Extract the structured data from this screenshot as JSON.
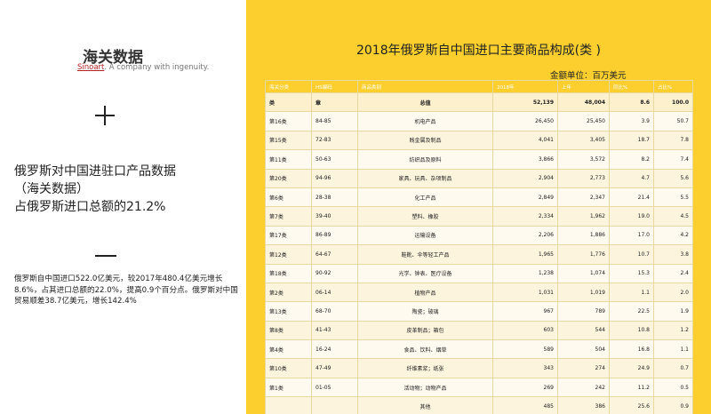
{
  "left": {
    "brand_title": "海关数据",
    "brand_sub_red": "Sinoart",
    "brand_sub_rest": ". A company with ingenuity.",
    "heading_lines": [
      "俄罗斯对中国进驻口产品数据",
      "（海关数据）",
      "占俄罗斯进口总额的21.2%"
    ],
    "paragraph": "俄罗斯自中国进口522.0亿美元，较2017年480.4亿美元增长8.6%，占其进口总额的22.0%，提高0.9个百分点。俄罗斯对中国贸易顺差38.7亿美元，增长142.4%"
  },
  "table": {
    "title": "2018年俄罗斯自中国进口主要商品构成(类 )",
    "unit": "金额单位：百万美元",
    "headers": [
      "海关分类",
      "HS编码",
      "商品类别",
      "2018年",
      "上年",
      "同比%",
      "占比%"
    ],
    "rows": [
      [
        "类",
        "章",
        "总值",
        "52,139",
        "48,004",
        "8.6",
        "100.0"
      ],
      [
        "第16类",
        "84-85",
        "机电产品",
        "26,450",
        "25,450",
        "3.9",
        "50.7"
      ],
      [
        "第15类",
        "72-83",
        "贱金属及制品",
        "4,041",
        "3,405",
        "18.7",
        "7.8"
      ],
      [
        "第11类",
        "50-63",
        "纺织品及原料",
        "3,866",
        "3,572",
        "8.2",
        "7.4"
      ],
      [
        "第20类",
        "94-96",
        "家具、玩具、杂项制品",
        "2,904",
        "2,773",
        "4.7",
        "5.6"
      ],
      [
        "第6类",
        "28-38",
        "化工产品",
        "2,849",
        "2,347",
        "21.4",
        "5.5"
      ],
      [
        "第7类",
        "39-40",
        "塑料、橡胶",
        "2,334",
        "1,962",
        "19.0",
        "4.5"
      ],
      [
        "第17类",
        "86-89",
        "运输设备",
        "2,206",
        "1,886",
        "17.0",
        "4.2"
      ],
      [
        "第12类",
        "64-67",
        "鞋靴、伞等轻工产品",
        "1,965",
        "1,776",
        "10.7",
        "3.8"
      ],
      [
        "第18类",
        "90-92",
        "光学、钟表、医疗设备",
        "1,238",
        "1,074",
        "15.3",
        "2.4"
      ],
      [
        "第2类",
        "06-14",
        "植物产品",
        "1,031",
        "1,019",
        "1.1",
        "2.0"
      ],
      [
        "第13类",
        "68-70",
        "陶瓷；玻璃",
        "967",
        "789",
        "22.5",
        "1.9"
      ],
      [
        "第8类",
        "41-43",
        "皮革制品；箱包",
        "603",
        "544",
        "10.8",
        "1.2"
      ],
      [
        "第4类",
        "16-24",
        "食品、饮料、烟草",
        "589",
        "504",
        "16.8",
        "1.1"
      ],
      [
        "第10类",
        "47-49",
        "纤维素浆；纸张",
        "343",
        "274",
        "24.9",
        "0.7"
      ],
      [
        "第1类",
        "01-05",
        "活动物；动物产品",
        "269",
        "242",
        "11.2",
        "0.5"
      ],
      [
        "",
        "",
        "其他",
        "485",
        "386",
        "25.6",
        "0.9"
      ]
    ]
  },
  "colors": {
    "accent": "#fccf2f",
    "brand_red": "#b22222"
  }
}
